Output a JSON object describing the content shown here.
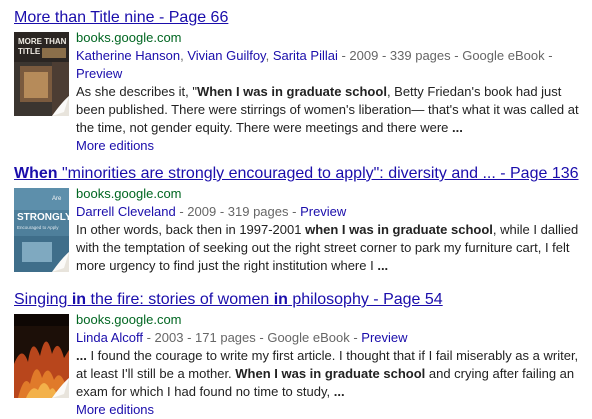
{
  "results": [
    {
      "title": "More than Title nine - Page 66",
      "url": "books.google.com",
      "authors": [
        "Katherine Hanson",
        "Vivian Guilfoy",
        "Sarita Pillai"
      ],
      "year": "2009",
      "pages": "339 pages",
      "source": "Google eBook",
      "preview": "Preview",
      "snippet_before": "As she describes it, \"",
      "snippet_bold": "When I was in graduate school",
      "snippet_after": ", Betty Friedan's book had just been published. There were stirrings of women's liberation— that's what it was called at the time, not gender equity. There were meetings and there were ",
      "snippet_end": "...",
      "more_editions": "More editions",
      "cover_text": [
        "MORE THAN",
        "TITLE IX"
      ]
    },
    {
      "title_bold": "When",
      "title_rest": " \"minorities are strongly encouraged to apply\": diversity and ... - Page 136",
      "url": "books.google.com",
      "authors": [
        "Darrell Cleveland"
      ],
      "year": "2009",
      "pages": "319 pages",
      "preview": "Preview",
      "snippet_before": "In other words, back then in 1997-2001 ",
      "snippet_bold": "when I was in graduate school",
      "snippet_after": ", while I dallied with the temptation of seeking out the right street corner to park my furniture cart, I felt more urgency to find just the right institution where I ",
      "snippet_end": "...",
      "cover_text": [
        "Are",
        "STRONGLY",
        "Encouraged to Apply"
      ]
    },
    {
      "title_part1": "Singing ",
      "title_bold1": "in",
      "title_part2": " the fire: stories of women ",
      "title_bold2": "in",
      "title_part3": " philosophy - Page 54",
      "url": "books.google.com",
      "authors": [
        "Linda Alcoff"
      ],
      "year": "2003",
      "pages": "171 pages",
      "source": "Google eBook",
      "preview": "Preview",
      "snippet_start": "...",
      "snippet_before": " I found the courage to write my first article. I thought that if I fail miserably as a writer, at least I'll still be a mother. ",
      "snippet_bold": "When I was in graduate school",
      "snippet_after": " and crying after failing an exam for which I had found no time to study, ",
      "snippet_end": "...",
      "more_editions": "More editions"
    }
  ],
  "separators": {
    "comma": ", ",
    "dash": " - "
  },
  "colors": {
    "link": "#1a0dab",
    "url": "#006621",
    "meta": "#666666",
    "text": "#222222"
  }
}
